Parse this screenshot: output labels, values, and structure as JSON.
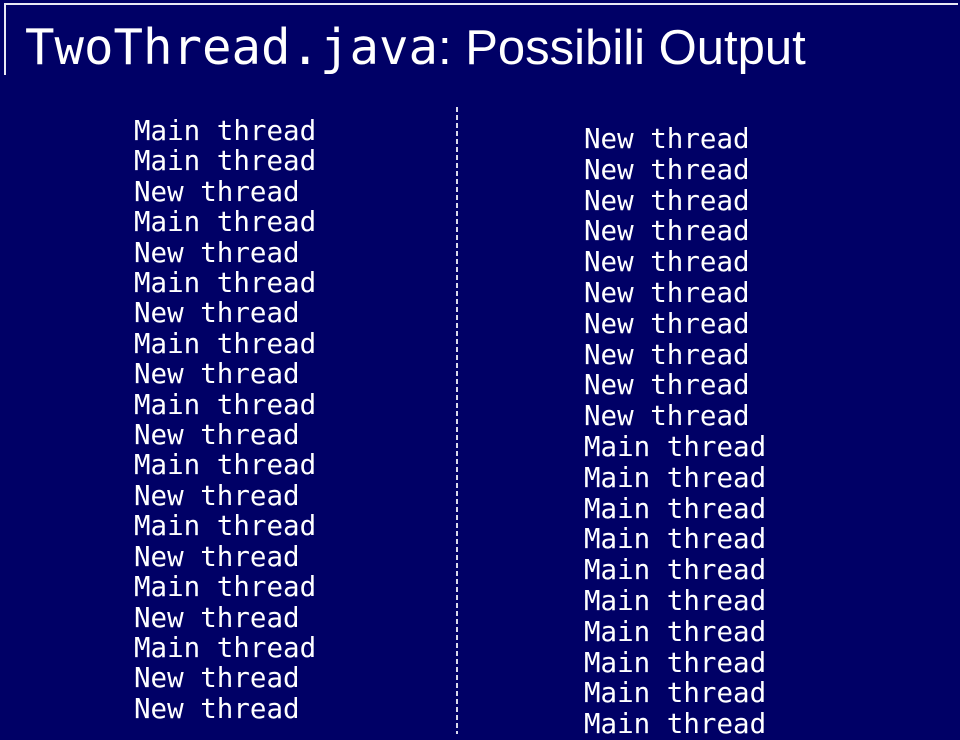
{
  "slide": {
    "title_code": "TwoThread.java",
    "title_text": ": Possibili Output",
    "colors": {
      "background": "#000066",
      "text": "#ffffff"
    }
  },
  "outputs": {
    "left": [
      "Main thread",
      "Main thread",
      "New thread",
      "Main thread",
      "New thread",
      "Main thread",
      "New thread",
      "Main thread",
      "New thread",
      "Main thread",
      "New thread",
      "Main thread",
      "New thread",
      "Main thread",
      "New thread",
      "Main thread",
      "New thread",
      "Main thread",
      "New thread",
      "New thread"
    ],
    "right": [
      "New thread",
      "New thread",
      "New thread",
      "New thread",
      "New thread",
      "New thread",
      "New thread",
      "New thread",
      "New thread",
      "New thread",
      "Main thread",
      "Main thread",
      "Main thread",
      "Main thread",
      "Main thread",
      "Main thread",
      "Main thread",
      "Main thread",
      "Main thread",
      "Main thread"
    ]
  }
}
